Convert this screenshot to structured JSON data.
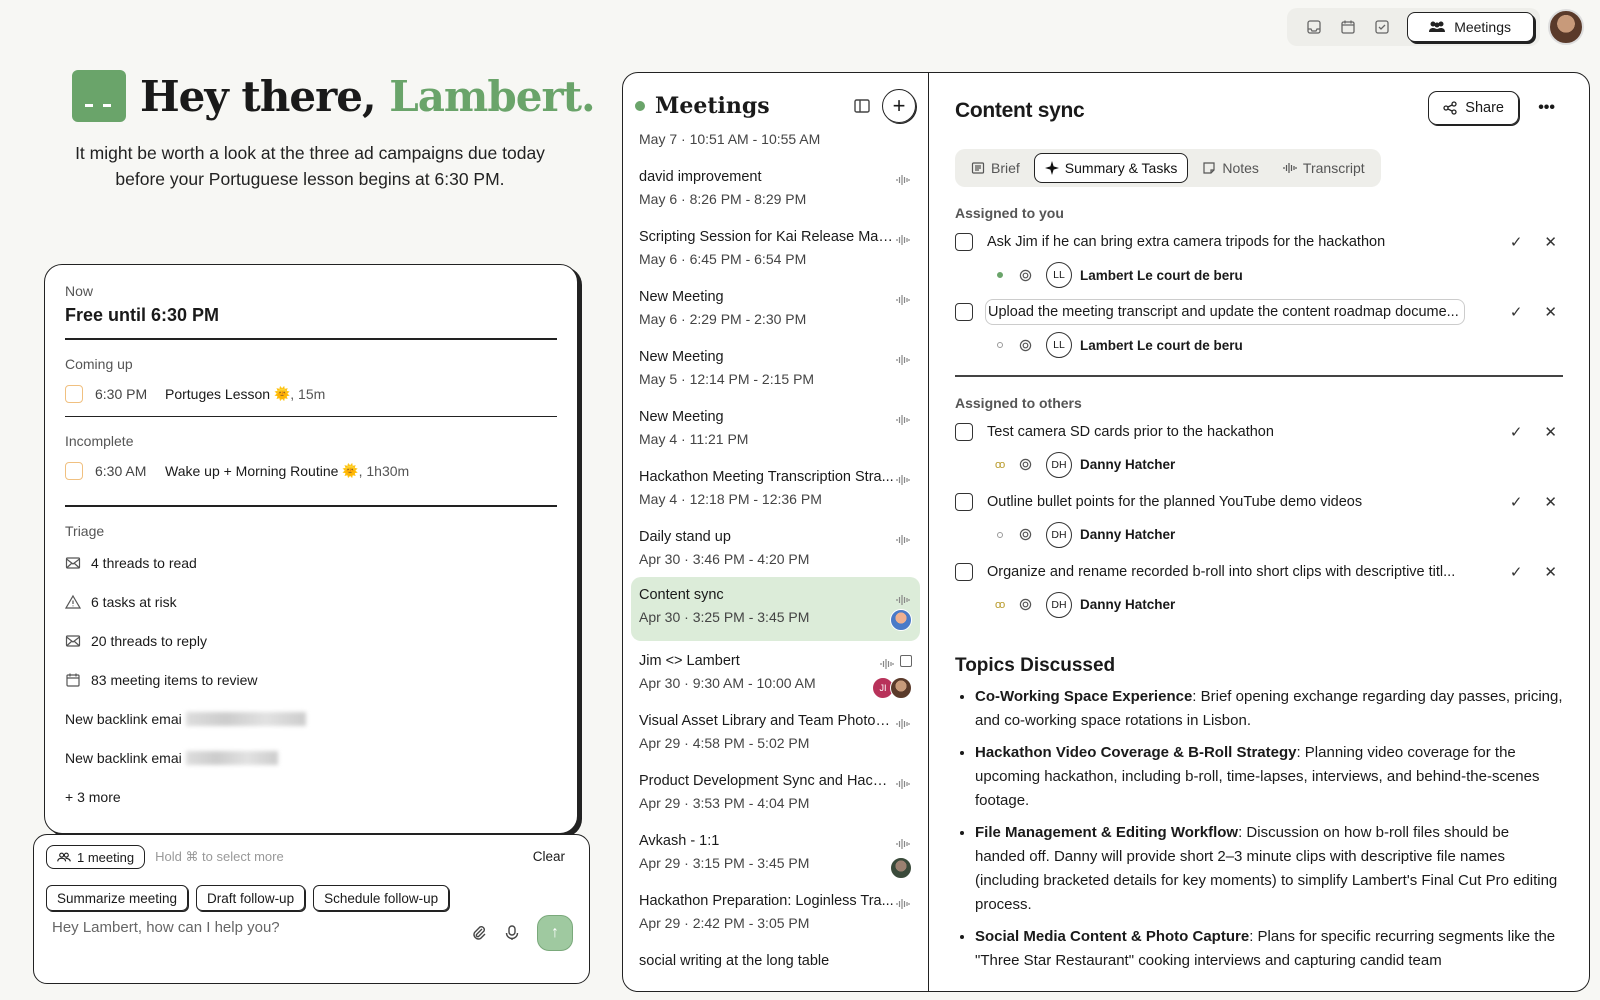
{
  "topbar": {
    "meetings_label": "Meetings"
  },
  "greeting": {
    "prefix": "Hey there, ",
    "name": "Lambert.",
    "subline": "It might be worth a look at the three ad campaigns due today before your Portuguese lesson begins at 6:30 PM."
  },
  "now": {
    "label": "Now",
    "status": "Free until 6:30 PM"
  },
  "coming_up": {
    "label": "Coming up",
    "time": "6:30 PM",
    "title": "Portuges Lesson",
    "emoji": "🌞",
    "duration": ", 15m"
  },
  "incomplete": {
    "label": "Incomplete",
    "time": "6:30 AM",
    "title": "Wake up + Morning Routine",
    "emoji": "🌞",
    "duration": ", 1h30m"
  },
  "triage": {
    "label": "Triage",
    "items": [
      "4 threads to read",
      "6 tasks at risk",
      "20 threads to reply",
      "83 meeting items to review"
    ],
    "backlinks": [
      "New backlink emai",
      "New backlink emai"
    ],
    "more": "+ 3 more"
  },
  "chat": {
    "chip": "1 meeting",
    "hint": "Hold ⌘ to select more",
    "clear": "Clear",
    "actions": [
      "Summarize meeting",
      "Draft follow-up",
      "Schedule follow-up"
    ],
    "placeholder": "Hey Lambert, how can I help you?"
  },
  "meetings": {
    "title": "Meetings",
    "first_date": "May 7 · 10:51 AM - 10:55 AM",
    "items": [
      {
        "title": "david improvement",
        "date": "May 6 · 8:26 PM - 8:29 PM"
      },
      {
        "title": "Scripting Session for Kai Release Mark...",
        "date": "May 6 · 6:45 PM - 6:54 PM"
      },
      {
        "title": "New Meeting",
        "date": "May 6 · 2:29 PM - 2:30 PM"
      },
      {
        "title": "New Meeting",
        "date": "May 5 · 12:14 PM - 2:15 PM"
      },
      {
        "title": "New Meeting",
        "date": "May 4 · 11:21 PM"
      },
      {
        "title": "Hackathon Meeting Transcription Stra...",
        "date": "May 4 · 12:18 PM - 12:36 PM"
      },
      {
        "title": "Daily stand up",
        "date": "Apr 30 · 3:46 PM - 4:20 PM"
      },
      {
        "title": "Content sync",
        "date": "Apr 30 · 3:25 PM - 3:45 PM"
      },
      {
        "title": "Jim <> Lambert",
        "date": "Apr 30 · 9:30 AM - 10:00 AM",
        "avatar_initials": "JI"
      },
      {
        "title": "Visual Asset Library and Team Photog...",
        "date": "Apr 29 · 4:58 PM - 5:02 PM"
      },
      {
        "title": "Product Development Sync and Hacka...",
        "date": "Apr 29 · 3:53 PM - 4:04 PM"
      },
      {
        "title": "Avkash - 1:1",
        "date": "Apr 29 · 3:15 PM - 3:45 PM"
      },
      {
        "title": "Hackathon Preparation: Loginless Tra...",
        "date": "Apr 29 · 2:42 PM - 3:05 PM"
      },
      {
        "title": "social writing at the long table",
        "date": ""
      }
    ]
  },
  "detail": {
    "title": "Content sync",
    "share": "Share",
    "tabs": [
      "Brief",
      "Summary & Tasks",
      "Notes",
      "Transcript"
    ],
    "assigned_you_label": "Assigned to you",
    "assigned_you": [
      {
        "text": "Ask Jim if he can bring extra camera tripods for the hackathon",
        "initials": "LL",
        "name": "Lambert Le court de beru"
      },
      {
        "text": "Upload the meeting transcript and update the content roadmap docume...",
        "initials": "LL",
        "name": "Lambert Le court de beru"
      }
    ],
    "assigned_others_label": "Assigned to others",
    "assigned_others": [
      {
        "text": "Test camera SD cards prior to the hackathon",
        "initials": "DH",
        "name": "Danny Hatcher"
      },
      {
        "text": "Outline bullet points for the planned YouTube demo videos",
        "initials": "DH",
        "name": "Danny Hatcher"
      },
      {
        "text": "Organize and rename recorded b-roll into short clips with descriptive titl...",
        "initials": "DH",
        "name": "Danny Hatcher"
      }
    ],
    "topics_title": "Topics Discussed",
    "topics": [
      {
        "head": "Co-Working Space Experience",
        "body": ": Brief opening exchange regarding day passes, pricing, and co-working space rotations in Lisbon."
      },
      {
        "head": "Hackathon Video Coverage & B-Roll Strategy",
        "body": ": Planning video coverage for the upcoming hackathon, including b-roll, time-lapses, interviews, and behind-the-scenes footage."
      },
      {
        "head": "File Management & Editing Workflow",
        "body": ": Discussion on how b-roll files should be handed off. Danny will provide short 2–3 minute clips with descriptive file names (including bracketed details for key moments) to simplify Lambert's Final Cut Pro editing process."
      },
      {
        "head": "Social Media Content & Photo Capture",
        "body": ": Plans for specific recurring segments like the \"Three Star Restaurant\" cooking interviews and capturing candid team"
      }
    ]
  },
  "colors": {
    "accent": "#6aa46a",
    "active_row": "#dcecd9"
  }
}
